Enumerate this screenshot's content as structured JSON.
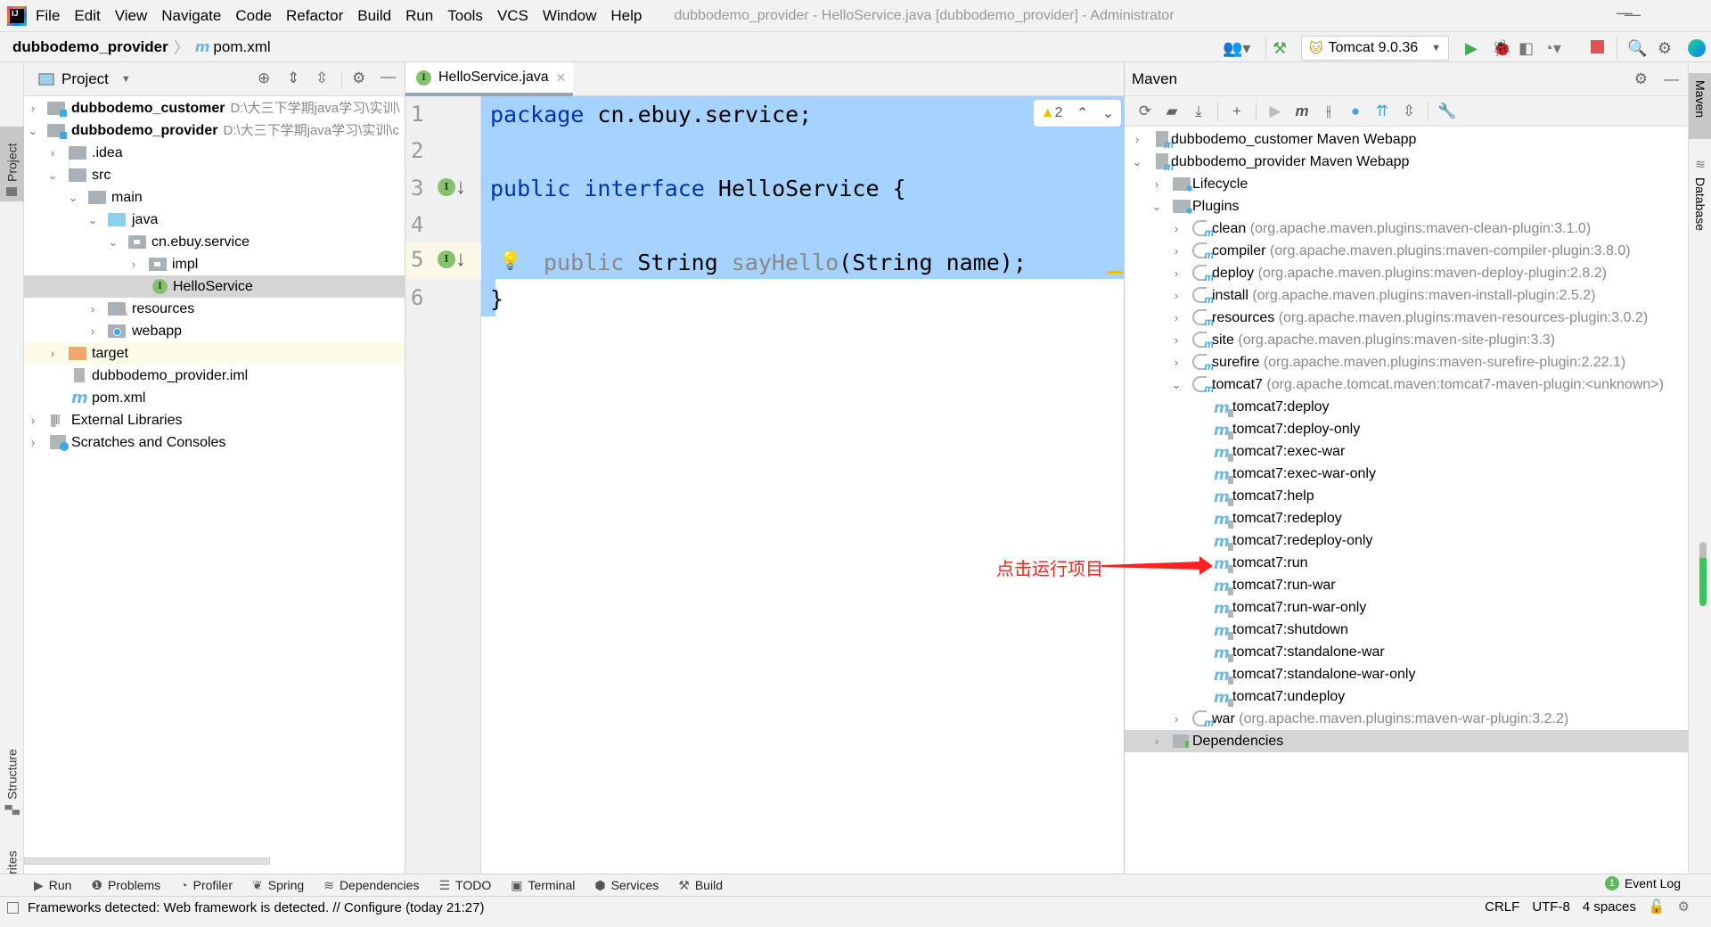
{
  "menubar": {
    "items": [
      "File",
      "Edit",
      "View",
      "Navigate",
      "Code",
      "Refactor",
      "Build",
      "Run",
      "Tools",
      "VCS",
      "Window",
      "Help"
    ],
    "window_title": "dubbodemo_provider - HelloService.java [dubbodemo_provider] - Administrator"
  },
  "navbar": {
    "project": "dubbodemo_provider",
    "file": "pom.xml",
    "run_config": "Tomcat 9.0.36"
  },
  "left_stripe": {
    "project": "Project",
    "structure": "Structure",
    "favorites": "Favorites"
  },
  "project_panel": {
    "title": "Project",
    "tree": [
      {
        "label": "dubbodemo_customer",
        "hint": "D:\\大三下学期java学习\\实训\\",
        "bold": true
      },
      {
        "label": "dubbodemo_provider",
        "hint": "D:\\大三下学期java学习\\实训\\c",
        "bold": true
      },
      {
        "label": ".idea"
      },
      {
        "label": "src"
      },
      {
        "label": "main"
      },
      {
        "label": "java"
      },
      {
        "label": "cn.ebuy.service"
      },
      {
        "label": "impl"
      },
      {
        "label": "HelloService"
      },
      {
        "label": "resources"
      },
      {
        "label": "webapp"
      },
      {
        "label": "target"
      },
      {
        "label": "dubbodemo_provider.iml"
      },
      {
        "label": "pom.xml"
      },
      {
        "label": "External Libraries"
      },
      {
        "label": "Scratches and Consoles"
      }
    ]
  },
  "editor": {
    "tab": "HelloService.java",
    "warnings": "2",
    "line_numbers": [
      "1",
      "2",
      "3",
      "4",
      "5",
      "6"
    ],
    "code": {
      "l1_kw": "package",
      "l1_rest": " cn.ebuy.service;",
      "l3_kw1": "public",
      "l3_kw2": "interface",
      "l3_rest": " HelloService {",
      "l5_kw": "public",
      "l5_type": " String ",
      "l5_method": "sayHello",
      "l5_rest": "(String name);",
      "l6": "}"
    }
  },
  "annotation": {
    "text": "点击运行项目",
    "color": "#ff2020"
  },
  "maven_panel": {
    "title": "Maven",
    "tree": {
      "customer": "dubbodemo_customer Maven Webapp",
      "provider": "dubbodemo_provider Maven Webapp",
      "lifecycle": "Lifecycle",
      "plugins": "Plugins",
      "plugin_list": [
        {
          "name": "clean",
          "coord": "(org.apache.maven.plugins:maven-clean-plugin:3.1.0)"
        },
        {
          "name": "compiler",
          "coord": "(org.apache.maven.plugins:maven-compiler-plugin:3.8.0)"
        },
        {
          "name": "deploy",
          "coord": "(org.apache.maven.plugins:maven-deploy-plugin:2.8.2)"
        },
        {
          "name": "install",
          "coord": "(org.apache.maven.plugins:maven-install-plugin:2.5.2)"
        },
        {
          "name": "resources",
          "coord": "(org.apache.maven.plugins:maven-resources-plugin:3.0.2)"
        },
        {
          "name": "site",
          "coord": "(org.apache.maven.plugins:maven-site-plugin:3.3)"
        },
        {
          "name": "surefire",
          "coord": "(org.apache.maven.plugins:maven-surefire-plugin:2.22.1)"
        },
        {
          "name": "tomcat7",
          "coord": "(org.apache.tomcat.maven:tomcat7-maven-plugin:<unknown>)"
        }
      ],
      "goals": [
        "tomcat7:deploy",
        "tomcat7:deploy-only",
        "tomcat7:exec-war",
        "tomcat7:exec-war-only",
        "tomcat7:help",
        "tomcat7:redeploy",
        "tomcat7:redeploy-only",
        "tomcat7:run",
        "tomcat7:run-war",
        "tomcat7:run-war-only",
        "tomcat7:shutdown",
        "tomcat7:standalone-war",
        "tomcat7:standalone-war-only",
        "tomcat7:undeploy"
      ],
      "war": {
        "name": "war",
        "coord": "(org.apache.maven.plugins:maven-war-plugin:3.2.2)"
      },
      "dependencies": "Dependencies"
    }
  },
  "right_stripe": {
    "maven": "Maven",
    "database": "Database"
  },
  "bottom_bar": {
    "tabs": [
      "Run",
      "Problems",
      "Profiler",
      "Spring",
      "Dependencies",
      "TODO",
      "Terminal",
      "Services",
      "Build"
    ],
    "event_log": "Event Log",
    "event_count": "1"
  },
  "status_bar": {
    "message": "Frameworks detected: Web framework is detected. // Configure (today 21:27)",
    "line_sep": "CRLF",
    "encoding": "UTF-8",
    "indent": "4 spaces"
  }
}
